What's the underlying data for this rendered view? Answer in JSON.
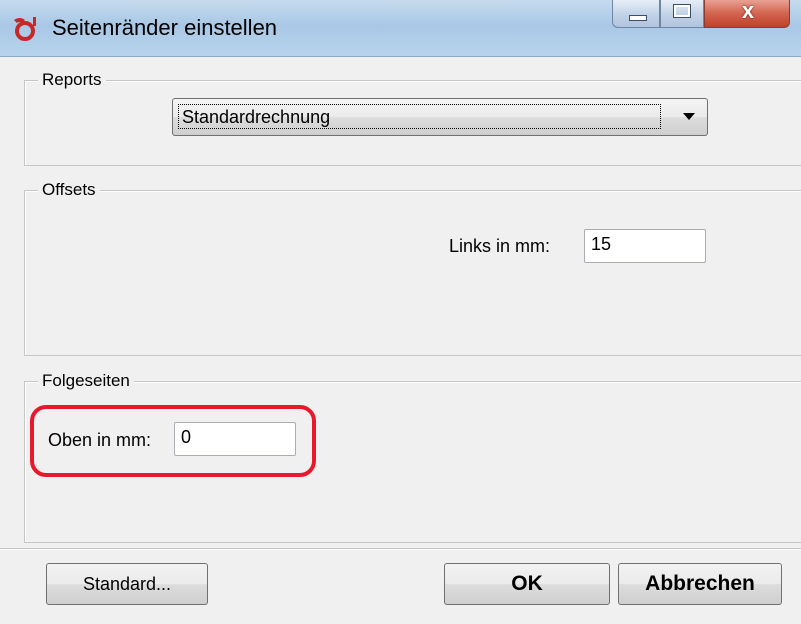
{
  "window": {
    "title": "Seitenränder einstellen",
    "close_symbol": "x"
  },
  "reports": {
    "group_label": "Reports",
    "selected": "Standardrechnung"
  },
  "offsets": {
    "group_label": "Offsets",
    "links_label": "Links in mm:",
    "links_value": "15"
  },
  "folgeseiten": {
    "group_label": "Folgeseiten",
    "oben_label": "Oben in mm:",
    "oben_value": "0"
  },
  "buttons": {
    "standard": "Standard...",
    "ok": "OK",
    "cancel": "Abbrechen"
  },
  "colors": {
    "highlight": "#e8192c",
    "titlebar": "#a9c8e6"
  }
}
